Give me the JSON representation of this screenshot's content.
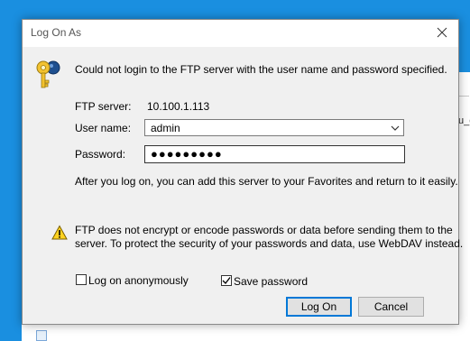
{
  "dialog": {
    "title": "Log On As",
    "message": "Could not login to the FTP server with the user name and password specified.",
    "ftp_server_label": "FTP server:",
    "ftp_server_value": "10.100.1.113",
    "username_label": "User name:",
    "username_value": "admin",
    "password_label": "Password:",
    "password_mask": "●●●●●●●●●",
    "favorites_info": "After you log on, you can add this server to your Favorites and return to it easily.",
    "warning_line1": "FTP does not encrypt or encode passwords or data before sending them to the",
    "warning_line2": "server.  To protect the security of your passwords and data, use WebDAV instead.",
    "anonymous_label": "Log on anonymously",
    "anonymous_checked": false,
    "save_password_label": "Save password",
    "save_password_checked": true,
    "logon_button": "Log On",
    "cancel_button": "Cancel"
  },
  "background": {
    "partial_text": "u_e"
  },
  "colors": {
    "desktop": "#1a8fe0",
    "dialog_bg": "#f0f0f0",
    "accent": "#0078d7"
  }
}
